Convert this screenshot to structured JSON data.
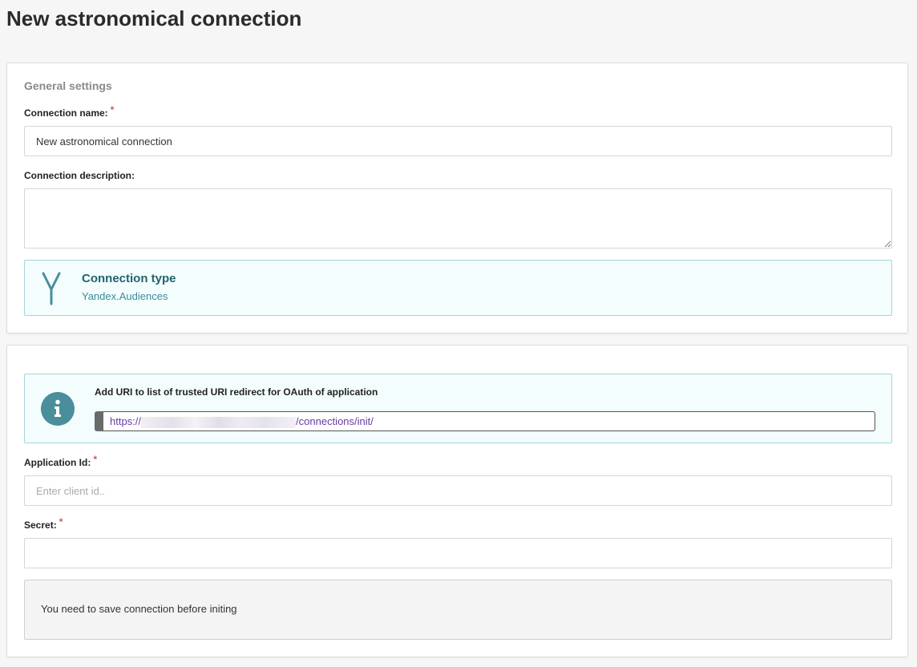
{
  "page": {
    "title": "New astronomical connection"
  },
  "general": {
    "section_title": "General settings",
    "name_label": "Connection name:",
    "name_value": "New astronomical connection",
    "description_label": "Connection description:",
    "description_value": "",
    "required_mark": "*"
  },
  "connection_type": {
    "title": "Connection type",
    "value": "Yandex.Audiences",
    "icon": "yandex-y-icon"
  },
  "oauth": {
    "info_icon": "info-icon",
    "info_text": "Add URI to list of trusted URI redirect for OAuth of application",
    "uri_prefix": "https://",
    "uri_suffix": "/connections/init/"
  },
  "credentials": {
    "app_id_label": "Application Id:",
    "app_id_placeholder": "Enter client id..",
    "app_id_value": "",
    "secret_label": "Secret:",
    "secret_value": ""
  },
  "notice": {
    "text": "You need to save connection before initing"
  },
  "colors": {
    "accent_teal": "#22636e",
    "info_bg": "#f3fdfd",
    "required": "#d9534f",
    "uri_text": "#6a3aa0"
  }
}
